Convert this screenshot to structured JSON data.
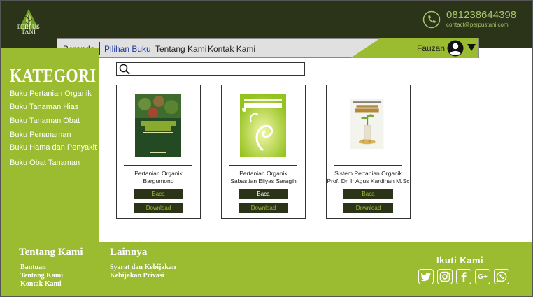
{
  "brand": {
    "logo_text_line1": "PERPUS",
    "logo_text_line2": "TANI"
  },
  "contact": {
    "phone": "081238644398",
    "email": "contact@perpustani.com",
    "phone_icon": "phone-icon"
  },
  "nav": {
    "items": [
      {
        "label": "Beranda",
        "active": false
      },
      {
        "label": "Pilihan Buku",
        "active": true
      },
      {
        "label": "Tentang Kami",
        "active": false
      },
      {
        "label": "Kontak Kami",
        "active": false
      }
    ],
    "user_name": "Fauzan",
    "avatar_icon": "user-avatar-icon",
    "dropdown_icon": "caret-down-icon"
  },
  "sidebar": {
    "heading": "KATEGORI",
    "items": [
      "Buku Pertanian Organik",
      "Buku Tanaman Hias",
      "Buku Tanaman Obat",
      "Buku Penanaman",
      "Buku Hama dan Penyakit",
      "Buku Obat Tanaman"
    ]
  },
  "search": {
    "placeholder": "",
    "value": "",
    "icon": "search-icon"
  },
  "books": [
    {
      "title": "Pertanian Organik",
      "author": "Bargumono",
      "read_label": "Baca",
      "download_label": "Download",
      "read_text_color": "#9bbb31",
      "download_text_color": "#9bbb31"
    },
    {
      "title": "Pertanian Organik",
      "author": "Sabastian Eliyas Saragih",
      "read_label": "Baca",
      "download_label": "Download",
      "read_text_color": "#ffffff",
      "download_text_color": "#9bbb31"
    },
    {
      "title": "Sistem Pertanian Organik",
      "author": "Prof. Dr. Ir Agus Kardinan M.Sc",
      "read_label": "Baca",
      "download_label": "Download",
      "read_text_color": "#9bbb31",
      "download_text_color": "#9bbb31"
    }
  ],
  "footer": {
    "about_heading": "Tentang Kami",
    "about_links": [
      "Bantuan",
      "Tentang Kami",
      "Kontak Kami"
    ],
    "other_heading": "Lainnya",
    "other_links": [
      "Syarat dan Kebijakan",
      "Kebijakan Privasi"
    ],
    "follow_heading": "Ikuti Kami",
    "social_icons": [
      "twitter-icon",
      "instagram-icon",
      "facebook-icon",
      "google-plus-icon",
      "whatsapp-icon"
    ]
  },
  "colors": {
    "dark": "#2b3419",
    "green": "#9bbb31",
    "nav_bg": "#e0e0e0",
    "active_nav": "#1e3aa0"
  }
}
